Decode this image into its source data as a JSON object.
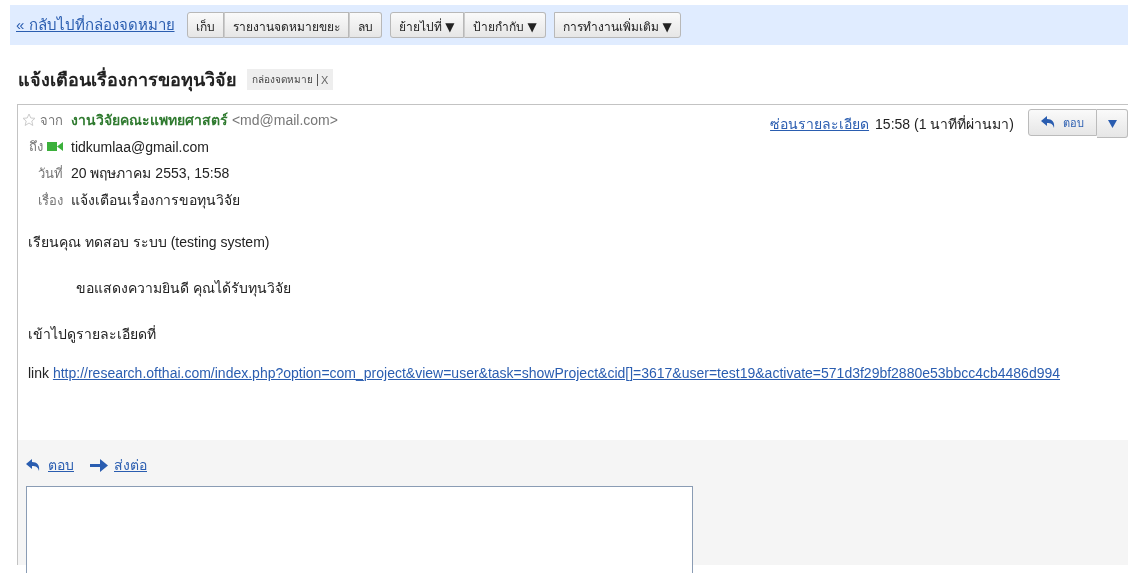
{
  "toolbar": {
    "back_link": "« กลับไปที่กล่องจดหมาย",
    "button_groups": [
      [
        "เก็บ",
        "รายงานจดหมายขยะ",
        "ลบ"
      ],
      [
        "ย้ายไปที่ ▼",
        "ป้ายกำกับ ▼"
      ],
      [
        "การทำงานเพิ่มเติม ▼"
      ]
    ]
  },
  "subject": {
    "title": "แจ้งเตือนเรื่องการขอทุนวิจัย",
    "label": "กล่องจดหมาย",
    "remove": "X"
  },
  "message": {
    "starred": false,
    "header": [
      {
        "kind": "from",
        "label": "จาก",
        "name": "งานวิจัยคณะแพทยศาสตร์",
        "value": "<md@mail.com>"
      },
      {
        "kind": "to",
        "label": "ถึง",
        "value": "tidkumlaa@gmail.com"
      },
      {
        "kind": "plain",
        "label": "วันที่",
        "value": "20 พฤษภาคม 2553, 15:58"
      },
      {
        "kind": "plain",
        "label": "เรื่อง",
        "value": "แจ้งเตือนเรื่องการขอทุนวิจัย"
      }
    ],
    "hide_details": "ซ่อนรายละเอียด",
    "time": "15:58 (1 นาทีที่ผ่านมา)",
    "reply_button": "ตอบ",
    "body": [
      {
        "kind": "para",
        "text": "เรียนคุณ ทดสอบ ระบบ (testing system)"
      },
      {
        "kind": "indent",
        "text": "ขอแสดงความยินดี คุณได้รับทุนวิจัย"
      },
      {
        "kind": "para",
        "text": "เข้าไปดูรายละเอียดที่"
      },
      {
        "kind": "link",
        "text": "link",
        "url": "http://research.ofthai.com/index.php?option=com_project&view=user&task=showProject&cid[]=3617&user=test19&activate=571d3f29bf2880e53bbcc4cb4486d994"
      }
    ],
    "reply_link": "ตอบ",
    "forward_link": "ส่งต่อ"
  }
}
